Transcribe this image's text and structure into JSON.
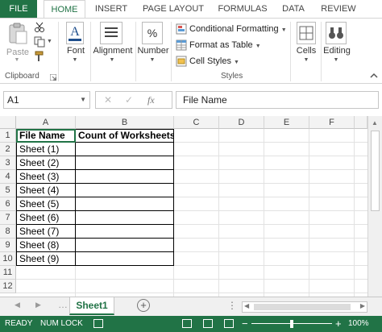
{
  "ribbon_tabs": [
    "FILE",
    "HOME",
    "INSERT",
    "PAGE LAYOUT",
    "FORMULAS",
    "DATA",
    "REVIEW"
  ],
  "active_tab": "HOME",
  "clipboard": {
    "paste_label": "Paste",
    "group_label": "Clipboard"
  },
  "font": {
    "label": "Font"
  },
  "alignment": {
    "label": "Alignment"
  },
  "number": {
    "label": "Number"
  },
  "styles": {
    "conditional_formatting": "Conditional Formatting",
    "format_as_table": "Format as Table",
    "cell_styles": "Cell Styles",
    "group_label": "Styles"
  },
  "cells": {
    "label": "Cells"
  },
  "editing": {
    "label": "Editing"
  },
  "formula_bar": {
    "name_box": "A1",
    "fx": "fx",
    "value": "File Name"
  },
  "columns": [
    "A",
    "B",
    "C",
    "D",
    "E",
    "F"
  ],
  "rows": [
    "1",
    "2",
    "3",
    "4",
    "5",
    "6",
    "7",
    "8",
    "9",
    "10",
    "11",
    "12"
  ],
  "table": {
    "headers": [
      "File Name",
      "Count of Worksheets"
    ],
    "rows": [
      [
        "Sheet (1)",
        ""
      ],
      [
        "Sheet (2)",
        ""
      ],
      [
        "Sheet (3)",
        ""
      ],
      [
        "Sheet (4)",
        ""
      ],
      [
        "Sheet (5)",
        ""
      ],
      [
        "Sheet (6)",
        ""
      ],
      [
        "Sheet (7)",
        ""
      ],
      [
        "Sheet (8)",
        ""
      ],
      [
        "Sheet (9)",
        ""
      ]
    ]
  },
  "sheet_tab": "Sheet1",
  "status": {
    "ready": "READY",
    "num_lock": "NUM LOCK",
    "zoom": "100%"
  },
  "colors": {
    "accent": "#217346"
  }
}
